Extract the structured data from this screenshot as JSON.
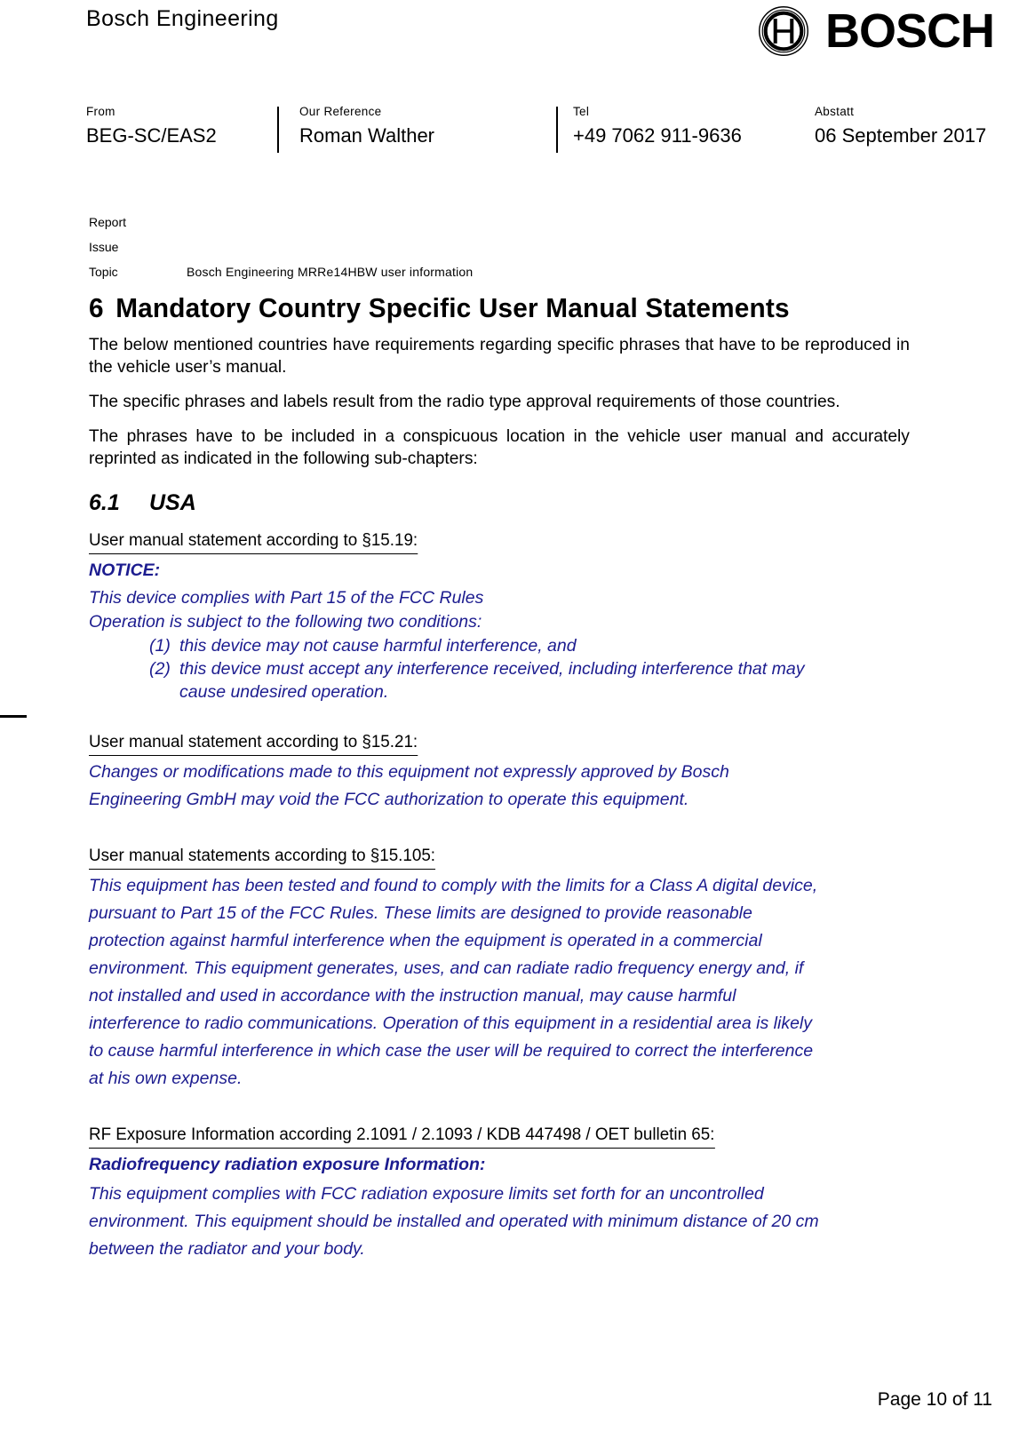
{
  "header": {
    "brand": "Bosch Engineering",
    "logo_word": "BOSCH",
    "logo_mark_name": "bosch-circle-anchor-logo"
  },
  "meta": {
    "fields": [
      {
        "label": "From",
        "value": "BEG-SC/EAS2"
      },
      {
        "label": "Our  Reference",
        "value": "Roman  Walther"
      },
      {
        "label": "Tel",
        "value": "+49 7062 911-9636"
      },
      {
        "label": "Abstatt",
        "value": "06 September 2017"
      }
    ]
  },
  "doc_meta": {
    "report_label": "Report",
    "report_value": "",
    "issue_label": "Issue",
    "issue_value": "",
    "topic_label": "Topic",
    "topic_value": "Bosch  Engineering  MRRe14HBW   user  information"
  },
  "chapter": {
    "number": "6",
    "title": "Mandatory  Country  Specific User  Manual  Statements",
    "paragraphs": [
      "The below mentioned countries have  requirements regarding specific phrases that have  to be reproduced in the vehicle user’s manual.",
      "The  specific  phrases  and  labels  result from  the  radio  type  approval  requirements of  those countries.",
      "The  phrases have  to  be included  in  a  conspicuous location  in  the vehicle  user manual  and accurately  reprinted as indicated  in the following sub-chapters:"
    ]
  },
  "subchapter": {
    "number": "6.1",
    "title": "USA"
  },
  "statements": [
    {
      "id": "15-19",
      "heading": "User manual  statement according  to §15.19:",
      "lead": "NOTICE:",
      "lines": [
        "This device complies with Part 15 of the FCC Rules",
        "Operation is  subject to the following two conditions:"
      ],
      "conditions": [
        {
          "marker": "(1)",
          "text": "this device may not cause harmful interference, and"
        },
        {
          "marker": "(2)",
          "text": "this device must accept any interference received, including interference that may"
        }
      ],
      "condition_continuation": "cause undesired operation."
    },
    {
      "id": "15-21",
      "heading": "User manual  statement according  to §15.21:",
      "lines": [
        "Changes or modifications made to this  equipment not expressly approved by Bosch",
        "Engineering GmbH may void the FCC authorization to operate this equipment."
      ]
    },
    {
      "id": "15-105",
      "heading": "User manual  statements according  to §15.105:",
      "lines": [
        "This equipment has been tested and found to comply with the limits for a Class A digital device,",
        "pursuant to  Part 15 of the FCC Rules. These limits are designed to provide reasonable",
        "protection against harmful interference when the equipment is operated in  a commercial",
        "environment. This equipment generates, uses, and can radiate radio frequency energy and, if",
        "not installed and used in accordance with the instruction manual, may cause harmful",
        "interference to radio communications. Operation of this  equipment in a residential area is likely",
        "to cause harmful interference in which case the user will be required to correct the interference",
        "at his own expense."
      ]
    },
    {
      "id": "rf-exposure",
      "heading": "RF Exposure Information according  2.1091 / 2.1093 / KDB 447498 / OET bulletin 65:",
      "lead": "Radiofrequency radiation exposure Information:",
      "lines": [
        "This equipment complies with FCC radiation exposure limits set forth for an uncontrolled",
        "environment. This equipment should be installed and operated with minimum distance of  20 cm",
        "between the radiator and your body."
      ]
    }
  ],
  "footer": {
    "page_text": "Page 10 of 11"
  },
  "colors": {
    "blue_text": "#1c1c8f",
    "body_text": "#000000",
    "background": "#ffffff"
  }
}
